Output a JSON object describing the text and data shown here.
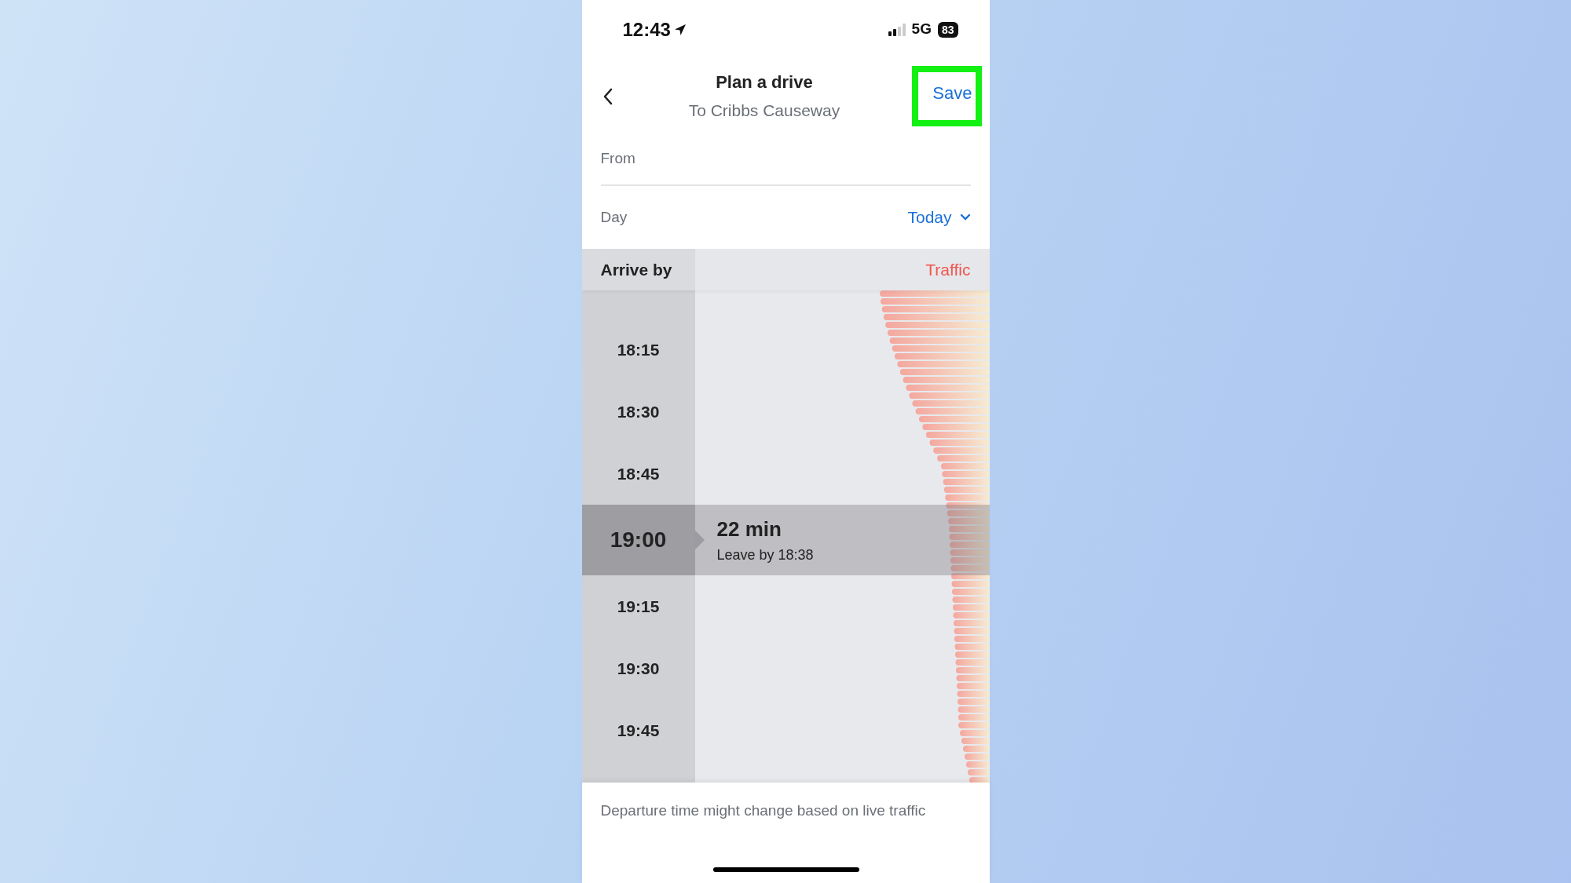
{
  "status_bar": {
    "time": "12:43",
    "network": "5G",
    "battery": "83"
  },
  "header": {
    "title": "Plan a drive",
    "subtitle": "To Cribbs Causeway",
    "save": {
      "label": "Save",
      "highlighted": true
    }
  },
  "form": [
    {
      "kind": "text",
      "label": "From"
    },
    {
      "kind": "dropdown",
      "label": "Day",
      "value": "Today"
    }
  ],
  "timeline": {
    "column_header": "Arrive by",
    "traffic_label": "Traffic",
    "slots": [
      {
        "time": "18:15",
        "selected": false
      },
      {
        "time": "18:30",
        "selected": false
      },
      {
        "time": "18:45",
        "selected": false
      },
      {
        "time": "19:00",
        "selected": true,
        "duration": "22 min",
        "leave_by": "Leave by 18:38"
      },
      {
        "time": "19:15",
        "selected": false
      },
      {
        "time": "19:30",
        "selected": false
      },
      {
        "time": "19:45",
        "selected": false
      }
    ]
  },
  "footer_note": "Departure time might change based on live traffic"
}
